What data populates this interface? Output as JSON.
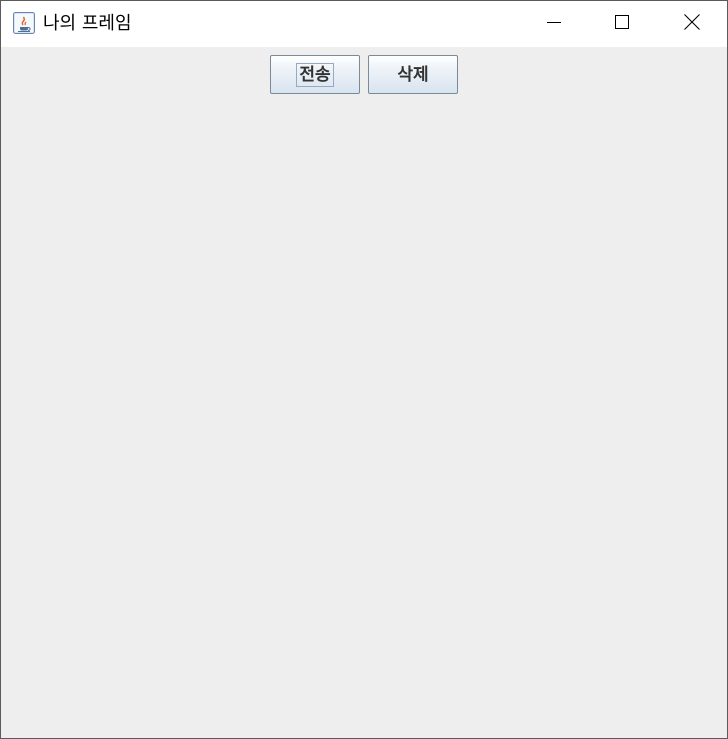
{
  "window": {
    "title": "나의 프레임",
    "app_icon": "java-coffee-icon",
    "controls": {
      "minimize_icon": "minimize-icon",
      "maximize_icon": "maximize-icon",
      "close_icon": "close-icon"
    }
  },
  "buttons": [
    {
      "label": "전송",
      "focused": true
    },
    {
      "label": "삭제",
      "focused": false
    }
  ],
  "colors": {
    "content_background": "#eeeeee",
    "titlebar_background": "#ffffff",
    "button_border": "#7a8a99"
  }
}
